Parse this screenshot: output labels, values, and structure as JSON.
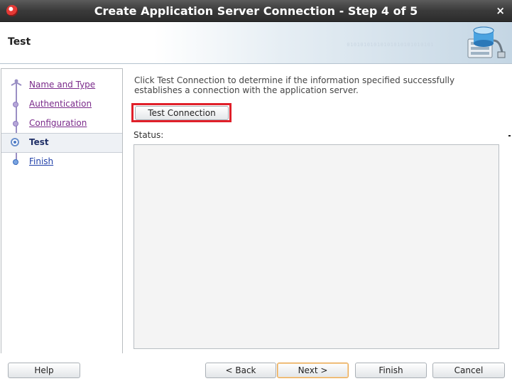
{
  "window": {
    "title": "Create Application Server Connection - Step 4 of 5",
    "close_glyph": "×"
  },
  "header": {
    "title": "Test",
    "binary_text": "01010101010101010101010101"
  },
  "steps": [
    {
      "label": "Name and Type",
      "state": "visited"
    },
    {
      "label": "Authentication",
      "state": "visited"
    },
    {
      "label": "Configuration",
      "state": "visited"
    },
    {
      "label": "Test",
      "state": "current"
    },
    {
      "label": "Finish",
      "state": "unvisited"
    }
  ],
  "content": {
    "description": "Click Test Connection to determine if the information specified successfully establishes a connection with the application server.",
    "test_button": "Test Connection",
    "status_label": "Status:"
  },
  "footer": {
    "help": "Help",
    "back": "< Back",
    "next": "Next >",
    "finish": "Finish",
    "cancel": "Cancel"
  },
  "colors": {
    "highlight": "#e0202a",
    "default_button_border": "#e8a650",
    "visited_link": "#7a2a8a",
    "link": "#1f3fa8"
  }
}
